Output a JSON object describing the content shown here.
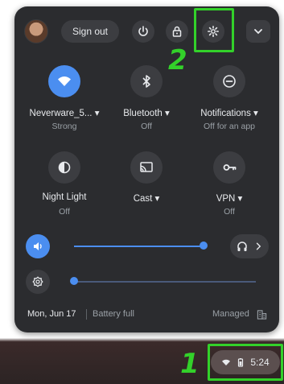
{
  "header": {
    "sign_out_label": "Sign out"
  },
  "tiles": [
    {
      "label": "Neverware_5...",
      "sub": "Strong",
      "icon": "wifi-icon",
      "active": true
    },
    {
      "label": "Bluetooth",
      "sub": "Off",
      "icon": "bluetooth-icon",
      "active": false
    },
    {
      "label": "Notifications",
      "sub": "Off for an app",
      "icon": "notifications-off-icon",
      "active": false
    },
    {
      "label": "Night Light",
      "sub": "Off",
      "icon": "night-light-icon",
      "active": false
    },
    {
      "label": "Cast",
      "sub": "",
      "icon": "cast-icon",
      "active": false
    },
    {
      "label": "VPN",
      "sub": "Off",
      "icon": "vpn-key-icon",
      "active": false
    }
  ],
  "sliders": {
    "volume_level": 0.98,
    "brightness_level": 0.0
  },
  "footer": {
    "date": "Mon, Jun 17",
    "battery": "Battery full",
    "managed": "Managed"
  },
  "tray": {
    "time": "5:24"
  },
  "annotations": {
    "tray_marker": "1",
    "settings_marker": "2"
  },
  "colors": {
    "panel_bg": "#2b2c2f",
    "accent": "#4b8ef0",
    "annotation": "#33d12a"
  }
}
